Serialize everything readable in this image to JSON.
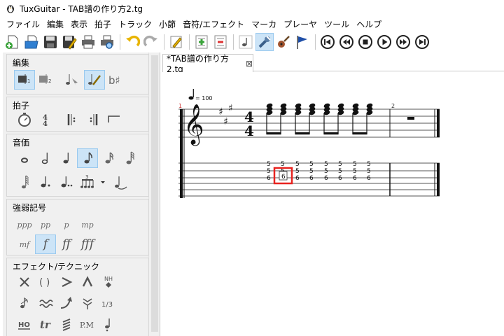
{
  "window": {
    "title": "TuxGuitar - TAB譜の作り方2.tg"
  },
  "menu": [
    "ファイル",
    "編集",
    "表示",
    "拍子",
    "トラック",
    "小節",
    "音符/エフェクト",
    "マーカ",
    "プレーヤ",
    "ツール",
    "ヘルプ"
  ],
  "toolbar": {
    "icons": [
      "new-file-icon",
      "open-file-icon",
      "save-icon",
      "save-as-icon",
      "print-icon",
      "print-preview-icon",
      "undo-icon",
      "redo-icon",
      "edit-pencil-icon",
      "add-track-icon",
      "remove-track-icon",
      "note-icon",
      "settings-wrench-icon",
      "guitar-icon",
      "marker-flag-icon",
      "first-icon",
      "previous-icon",
      "stop-icon",
      "play-icon",
      "next-icon",
      "last-icon"
    ],
    "active": [
      "settings-wrench-icon"
    ]
  },
  "panel": {
    "groups": {
      "edit": "編集",
      "time": "拍子",
      "duration": "音価",
      "dynamics": "強弱記号",
      "effects": "エフェクト/テクニック"
    },
    "dynamics": [
      "ppp",
      "pp",
      "p",
      "mp",
      "mf",
      "f",
      "ff",
      "fff"
    ],
    "dynamics_selected": "f",
    "effect_labels": {
      "tuplet": "1/3",
      "hammer_on": "HO",
      "trill": "tr",
      "palm_mute": "P.M",
      "natural_harmonic": "NH"
    }
  },
  "tab": {
    "label": "*TAB譜の作り方2.tg",
    "close": "⊠"
  },
  "score": {
    "tempo": "= 100",
    "time_signature": {
      "top": "4",
      "bottom": "4"
    },
    "measure_numbers": [
      "1",
      "2"
    ],
    "tab_rows": [
      [
        "5",
        "5",
        "5",
        "5",
        "5",
        "5",
        "5",
        "5"
      ],
      [
        "5",
        "5",
        "5",
        "5",
        "5",
        "5",
        "5",
        "5"
      ],
      [
        "6",
        "6",
        "6",
        "6",
        "6",
        "6",
        "6",
        "6"
      ]
    ],
    "selected_fret": "6",
    "colors": {
      "selection": "#e8231f",
      "selection_fill": "#ffffff"
    }
  }
}
